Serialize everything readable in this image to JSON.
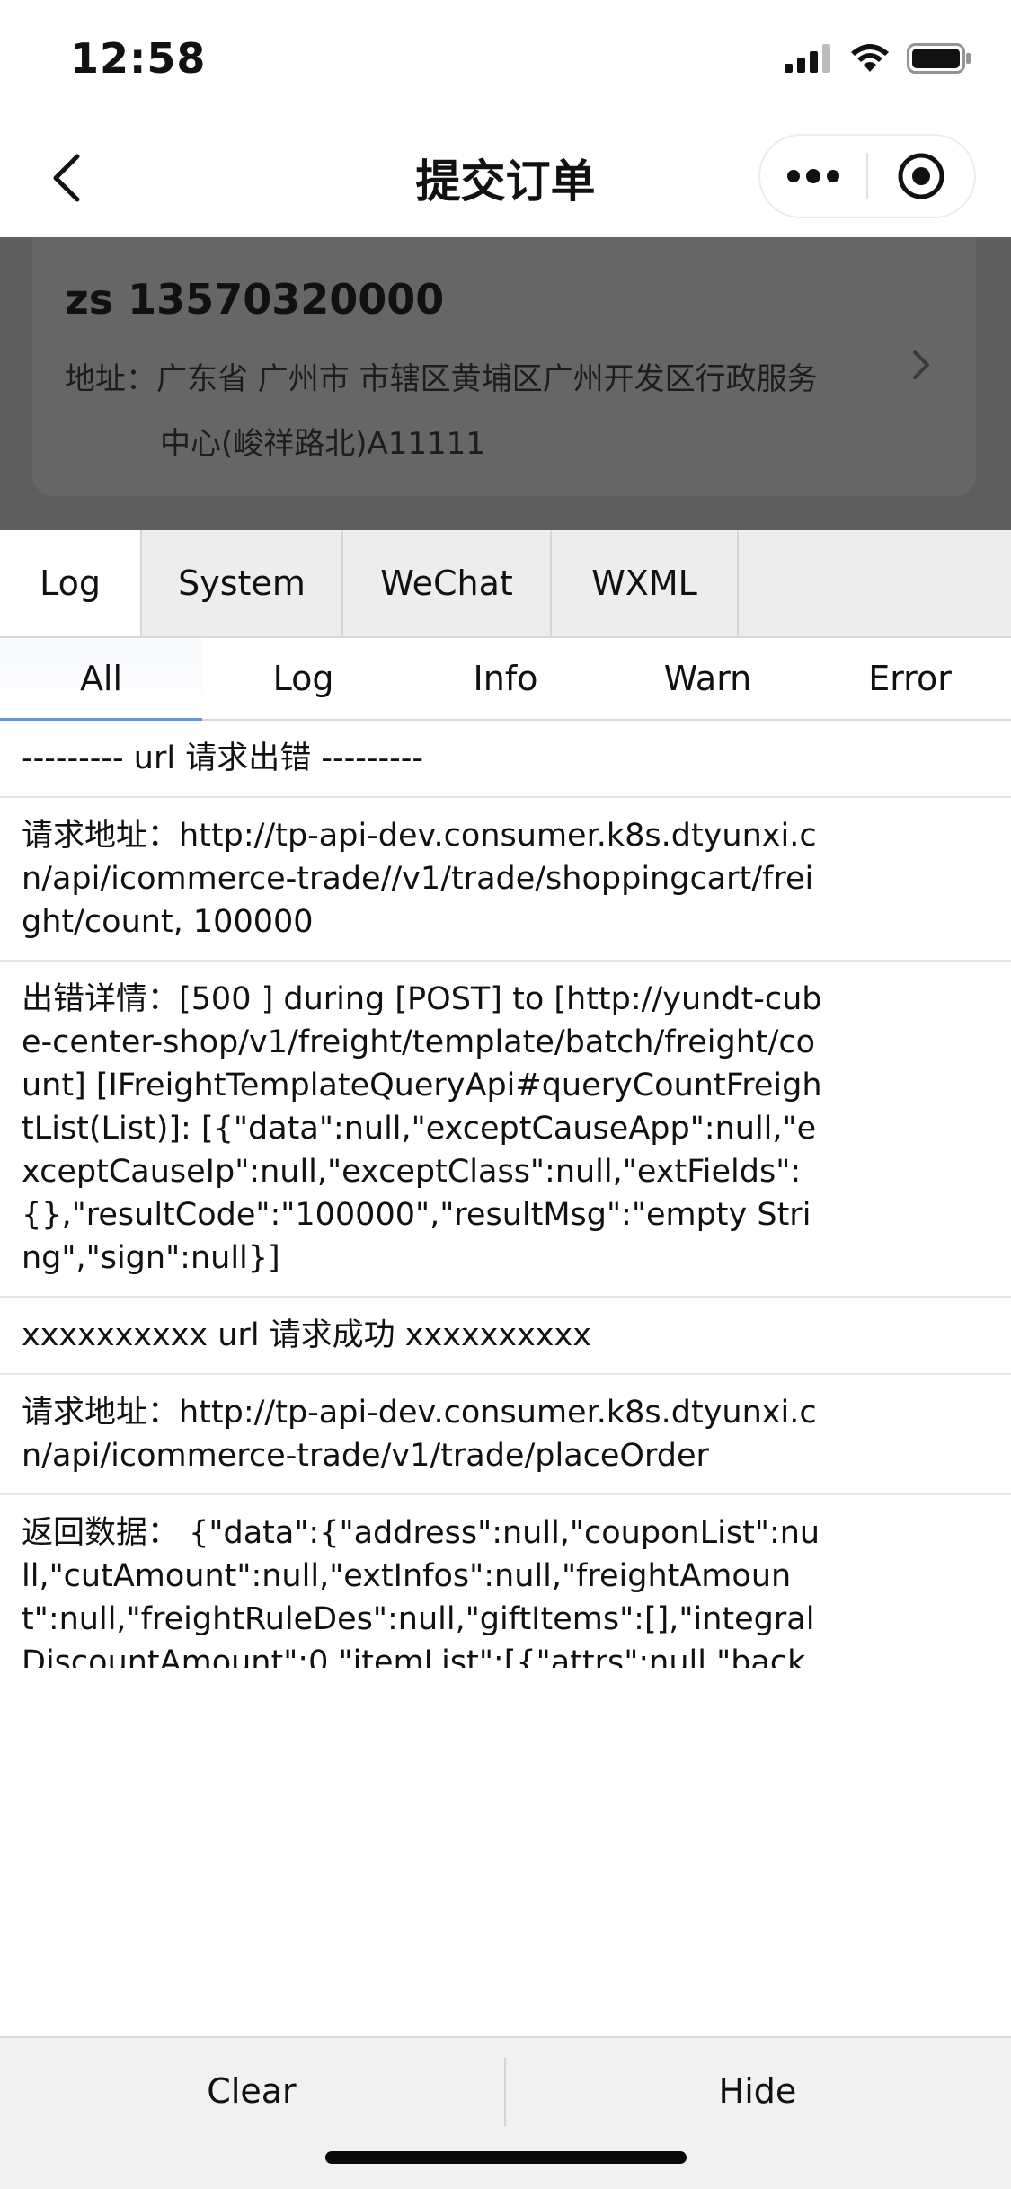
{
  "status_bar": {
    "time": "12:58"
  },
  "nav": {
    "title": "提交订单"
  },
  "address": {
    "name_phone": "zs  13570320000",
    "line1": "地址：广东省 广州市 市辖区黄埔区广州开发区行政服务",
    "line2": "中心(峻祥路北)A11111"
  },
  "debug": {
    "top_tabs": [
      {
        "label": "Log"
      },
      {
        "label": "System"
      },
      {
        "label": "WeChat"
      },
      {
        "label": "WXML"
      }
    ],
    "sub_tabs": [
      {
        "label": "All"
      },
      {
        "label": "Log"
      },
      {
        "label": "Info"
      },
      {
        "label": "Warn"
      },
      {
        "label": "Error"
      }
    ],
    "entries": [
      {
        "text": "--------- url 请求出错 ---------"
      },
      {
        "text": "请求地址：http://tp-api-dev.consumer.k8s.dtyunxi.cn/api/icommerce-trade//v1/trade/shoppingcart/freight/count, 100000"
      },
      {
        "text": "出错详情：[500 ] during [POST] to [http://yundt-cube-center-shop/v1/freight/template/batch/freight/count] [IFreightTemplateQueryApi#queryCountFreightList(List)]: [{\"data\":null,\"exceptCauseApp\":null,\"exceptCauseIp\":null,\"exceptClass\":null,\"extFields\":{},\"resultCode\":\"100000\",\"resultMsg\":\"empty String\",\"sign\":null}]"
      },
      {
        "text": "xxxxxxxxxx url 请求成功 xxxxxxxxxx"
      },
      {
        "text": "请求地址：http://tp-api-dev.consumer.k8s.dtyunxi.cn/api/icommerce-trade/v1/trade/placeOrder"
      },
      {
        "text": "返回数据： {\"data\":{\"address\":null,\"couponList\":null,\"cutAmount\":null,\"extInfos\":null,\"freightAmount\":null,\"freightRuleDes\":null,\"giftItems\":[],\"integralDiscountAmount\":0,\"itemList\":[{\"attrs\":null,\"backDirLabelId\":null,\"backDirLabelName\":null,\"busType\":0,\"cashAmount\":null,\"cashIntegral\":null,\"cashLimit\":null,\"cashType\":null,\"cycleEnd\":null,\"cycleItemNum\":null,\"cycleStart\":null,\"cycle"
      }
    ],
    "clear_label": "Clear",
    "hide_label": "Hide"
  }
}
